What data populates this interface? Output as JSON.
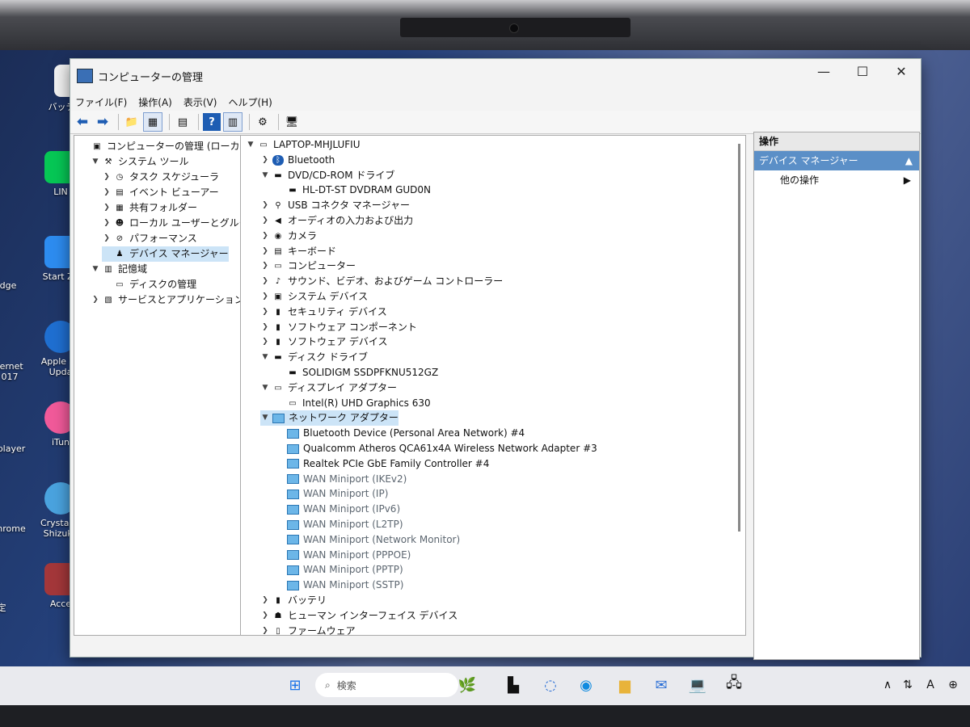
{
  "window": {
    "title": "コンピューターの管理"
  },
  "menu": [
    "ファイル(F)",
    "操作(A)",
    "表示(V)",
    "ヘルプ(H)"
  ],
  "left_tree": [
    {
      "label": "コンピューターの管理 (ローカル)",
      "indent": 0,
      "arrow": "",
      "icon": "computer-mgmt-icon"
    },
    {
      "label": "システム ツール",
      "indent": 1,
      "arrow": "v",
      "icon": "tools-icon"
    },
    {
      "label": "タスク スケジューラ",
      "indent": 2,
      "arrow": ">",
      "icon": "clock-icon"
    },
    {
      "label": "イベント ビューアー",
      "indent": 2,
      "arrow": ">",
      "icon": "event-viewer-icon"
    },
    {
      "label": "共有フォルダー",
      "indent": 2,
      "arrow": ">",
      "icon": "shared-folder-icon"
    },
    {
      "label": "ローカル ユーザーとグループ",
      "indent": 2,
      "arrow": ">",
      "icon": "users-icon"
    },
    {
      "label": "パフォーマンス",
      "indent": 2,
      "arrow": ">",
      "icon": "performance-icon"
    },
    {
      "label": "デバイス マネージャー",
      "indent": 2,
      "arrow": "",
      "icon": "device-manager-icon",
      "selected": true
    },
    {
      "label": "記憶域",
      "indent": 1,
      "arrow": "v",
      "icon": "storage-icon"
    },
    {
      "label": "ディスクの管理",
      "indent": 2,
      "arrow": "",
      "icon": "disk-mgmt-icon"
    },
    {
      "label": "サービスとアプリケーション",
      "indent": 1,
      "arrow": ">",
      "icon": "services-icon"
    }
  ],
  "device_tree": [
    {
      "label": "LAPTOP-MHJLUFIU",
      "indent": 0,
      "arrow": "v",
      "icon": "laptop-icon"
    },
    {
      "label": "Bluetooth",
      "indent": 1,
      "arrow": ">",
      "icon": "bluetooth-icon"
    },
    {
      "label": "DVD/CD-ROM ドライブ",
      "indent": 1,
      "arrow": "v",
      "icon": "dvd-icon"
    },
    {
      "label": "HL-DT-ST DVDRAM GUD0N",
      "indent": 2,
      "arrow": "",
      "icon": "dvd-drive-icon"
    },
    {
      "label": "USB コネクタ マネージャー",
      "indent": 1,
      "arrow": ">",
      "icon": "usb-icon"
    },
    {
      "label": "オーディオの入力および出力",
      "indent": 1,
      "arrow": ">",
      "icon": "speaker-icon"
    },
    {
      "label": "カメラ",
      "indent": 1,
      "arrow": ">",
      "icon": "camera-icon"
    },
    {
      "label": "キーボード",
      "indent": 1,
      "arrow": ">",
      "icon": "keyboard-icon"
    },
    {
      "label": "コンピューター",
      "indent": 1,
      "arrow": ">",
      "icon": "monitor-icon"
    },
    {
      "label": "サウンド、ビデオ、およびゲーム コントローラー",
      "indent": 1,
      "arrow": ">",
      "icon": "sound-icon"
    },
    {
      "label": "システム デバイス",
      "indent": 1,
      "arrow": ">",
      "icon": "system-device-icon"
    },
    {
      "label": "セキュリティ デバイス",
      "indent": 1,
      "arrow": ">",
      "icon": "security-icon"
    },
    {
      "label": "ソフトウェア コンポーネント",
      "indent": 1,
      "arrow": ">",
      "icon": "software-component-icon"
    },
    {
      "label": "ソフトウェア デバイス",
      "indent": 1,
      "arrow": ">",
      "icon": "software-device-icon"
    },
    {
      "label": "ディスク ドライブ",
      "indent": 1,
      "arrow": "v",
      "icon": "disk-icon"
    },
    {
      "label": "SOLIDIGM SSDPFKNU512GZ",
      "indent": 2,
      "arrow": "",
      "icon": "ssd-icon"
    },
    {
      "label": "ディスプレイ アダプター",
      "indent": 1,
      "arrow": "v",
      "icon": "display-adapter-icon"
    },
    {
      "label": "Intel(R) UHD Graphics 630",
      "indent": 2,
      "arrow": "",
      "icon": "display-adapter-icon"
    },
    {
      "label": "ネットワーク アダプター",
      "indent": 1,
      "arrow": "v",
      "icon": "network-icon",
      "selected": true
    },
    {
      "label": "Bluetooth Device (Personal Area Network) #4",
      "indent": 2,
      "arrow": "",
      "icon": "network-icon"
    },
    {
      "label": "Qualcomm Atheros QCA61x4A Wireless Network Adapter #3",
      "indent": 2,
      "arrow": "",
      "icon": "network-icon"
    },
    {
      "label": "Realtek PCIe GbE Family Controller #4",
      "indent": 2,
      "arrow": "",
      "icon": "network-icon"
    },
    {
      "label": "WAN Miniport (IKEv2)",
      "indent": 2,
      "arrow": "",
      "icon": "network-icon"
    },
    {
      "label": "WAN Miniport (IP)",
      "indent": 2,
      "arrow": "",
      "icon": "network-icon"
    },
    {
      "label": "WAN Miniport (IPv6)",
      "indent": 2,
      "arrow": "",
      "icon": "network-icon"
    },
    {
      "label": "WAN Miniport (L2TP)",
      "indent": 2,
      "arrow": "",
      "icon": "network-icon"
    },
    {
      "label": "WAN Miniport (Network Monitor)",
      "indent": 2,
      "arrow": "",
      "icon": "network-icon"
    },
    {
      "label": "WAN Miniport (PPPOE)",
      "indent": 2,
      "arrow": "",
      "icon": "network-icon"
    },
    {
      "label": "WAN Miniport (PPTP)",
      "indent": 2,
      "arrow": "",
      "icon": "network-icon"
    },
    {
      "label": "WAN Miniport (SSTP)",
      "indent": 2,
      "arrow": "",
      "icon": "network-icon"
    },
    {
      "label": "バッテリ",
      "indent": 1,
      "arrow": ">",
      "icon": "battery-icon"
    },
    {
      "label": "ヒューマン インターフェイス デバイス",
      "indent": 1,
      "arrow": ">",
      "icon": "hid-icon"
    },
    {
      "label": "ファームウェア",
      "indent": 1,
      "arrow": ">",
      "icon": "firmware-icon"
    }
  ],
  "actions": {
    "header": "操作",
    "selected": "デバイス マネージャー",
    "other": "他の操作"
  },
  "desktop_icons": [
    {
      "label": "バッテリー",
      "color": "#ffffff"
    },
    {
      "label": "LIN",
      "color": "#06c755"
    },
    {
      "label": "Start Zo",
      "color": "#2d8cf0"
    },
    {
      "label": "Apple So Upda",
      "color": "#1f6fd1"
    },
    {
      "label": "iTun",
      "color": "#f15a9a"
    },
    {
      "label": "CrystalDi Shizuku",
      "color": "#4aa3df"
    },
    {
      "label": "Acce",
      "color": "#a4373a"
    }
  ],
  "desktop_left_labels": [
    "dge",
    "ternet 017",
    "player",
    "hrome",
    "定"
  ],
  "taskbar": {
    "search_placeholder": "検索"
  }
}
